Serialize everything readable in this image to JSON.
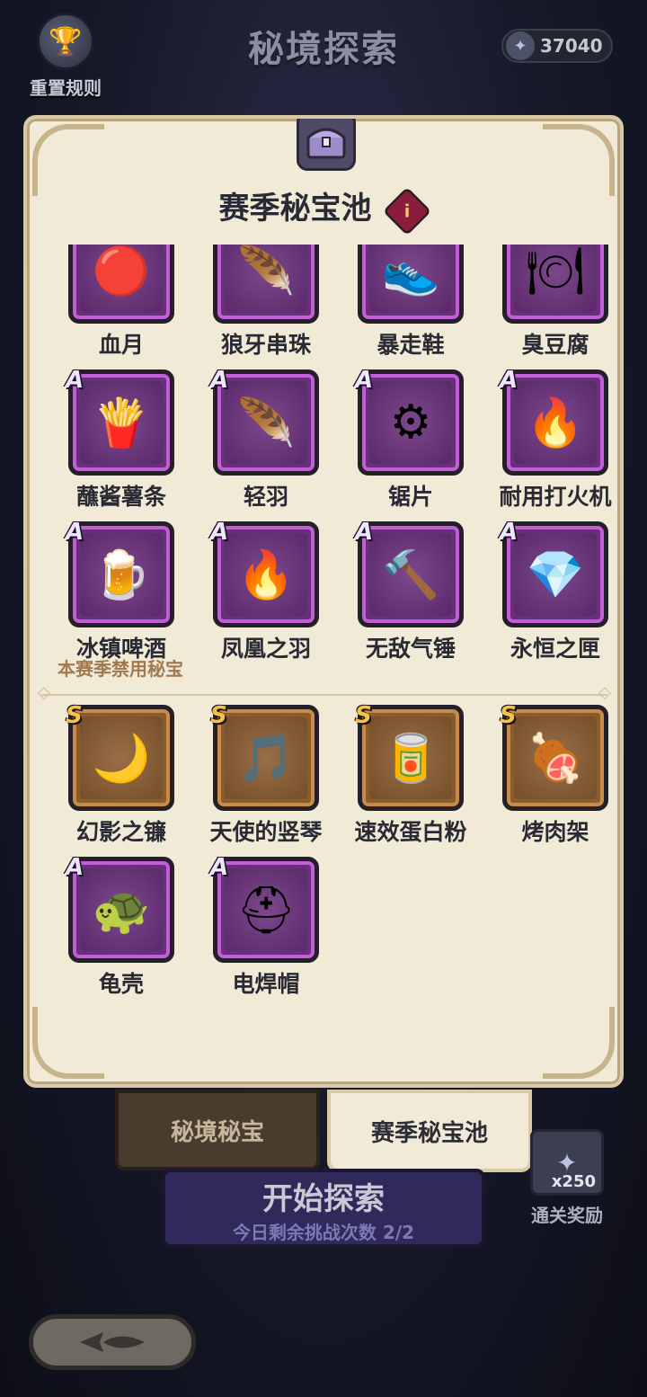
{
  "header": {
    "title": "秘境探索",
    "reset_rules_label": "重置规则",
    "currency_value": "37040"
  },
  "panel": {
    "title": "赛季秘宝池",
    "info_glyph": "i",
    "pool_items": [
      {
        "name": "血月",
        "rank": "",
        "emoji": "🔴"
      },
      {
        "name": "狼牙串珠",
        "rank": "",
        "emoji": "🪶"
      },
      {
        "name": "暴走鞋",
        "rank": "",
        "emoji": "👟"
      },
      {
        "name": "臭豆腐",
        "rank": "",
        "emoji": "🍽"
      },
      {
        "name": "蘸酱薯条",
        "rank": "A",
        "emoji": "🍟"
      },
      {
        "name": "轻羽",
        "rank": "A",
        "emoji": "🪶"
      },
      {
        "name": "锯片",
        "rank": "A",
        "emoji": "⚙"
      },
      {
        "name": "耐用打火机",
        "rank": "A",
        "emoji": "🔥"
      },
      {
        "name": "冰镇啤酒",
        "rank": "A",
        "emoji": "🍺"
      },
      {
        "name": "凤凰之羽",
        "rank": "A",
        "emoji": "🔥"
      },
      {
        "name": "无敌气锤",
        "rank": "A",
        "emoji": "🔨"
      },
      {
        "name": "永恒之匣",
        "rank": "A",
        "emoji": "💎"
      }
    ],
    "banned_label": "本赛季禁用秘宝",
    "banned_items": [
      {
        "name": "幻影之镰",
        "rank": "S",
        "emoji": "🌙"
      },
      {
        "name": "天使的竖琴",
        "rank": "S",
        "emoji": "🎵"
      },
      {
        "name": "速效蛋白粉",
        "rank": "S",
        "emoji": "🥫"
      },
      {
        "name": "烤肉架",
        "rank": "S",
        "emoji": "🍖"
      },
      {
        "name": "龟壳",
        "rank": "A",
        "emoji": "🐢"
      },
      {
        "name": "电焊帽",
        "rank": "A",
        "emoji": "⛑"
      }
    ]
  },
  "tabs": {
    "left": "秘境秘宝",
    "right": "赛季秘宝池"
  },
  "start": {
    "title": "开始探索",
    "subtitle": "今日剩余挑战次数 2/2"
  },
  "reward": {
    "count": "x250",
    "label": "通关奖励"
  },
  "colors": {
    "panel_bg": "#f1ead7",
    "rank_a_frame": "#c25ed8",
    "rank_s_frame": "#c78c47",
    "title_text": "#2a2a35"
  }
}
